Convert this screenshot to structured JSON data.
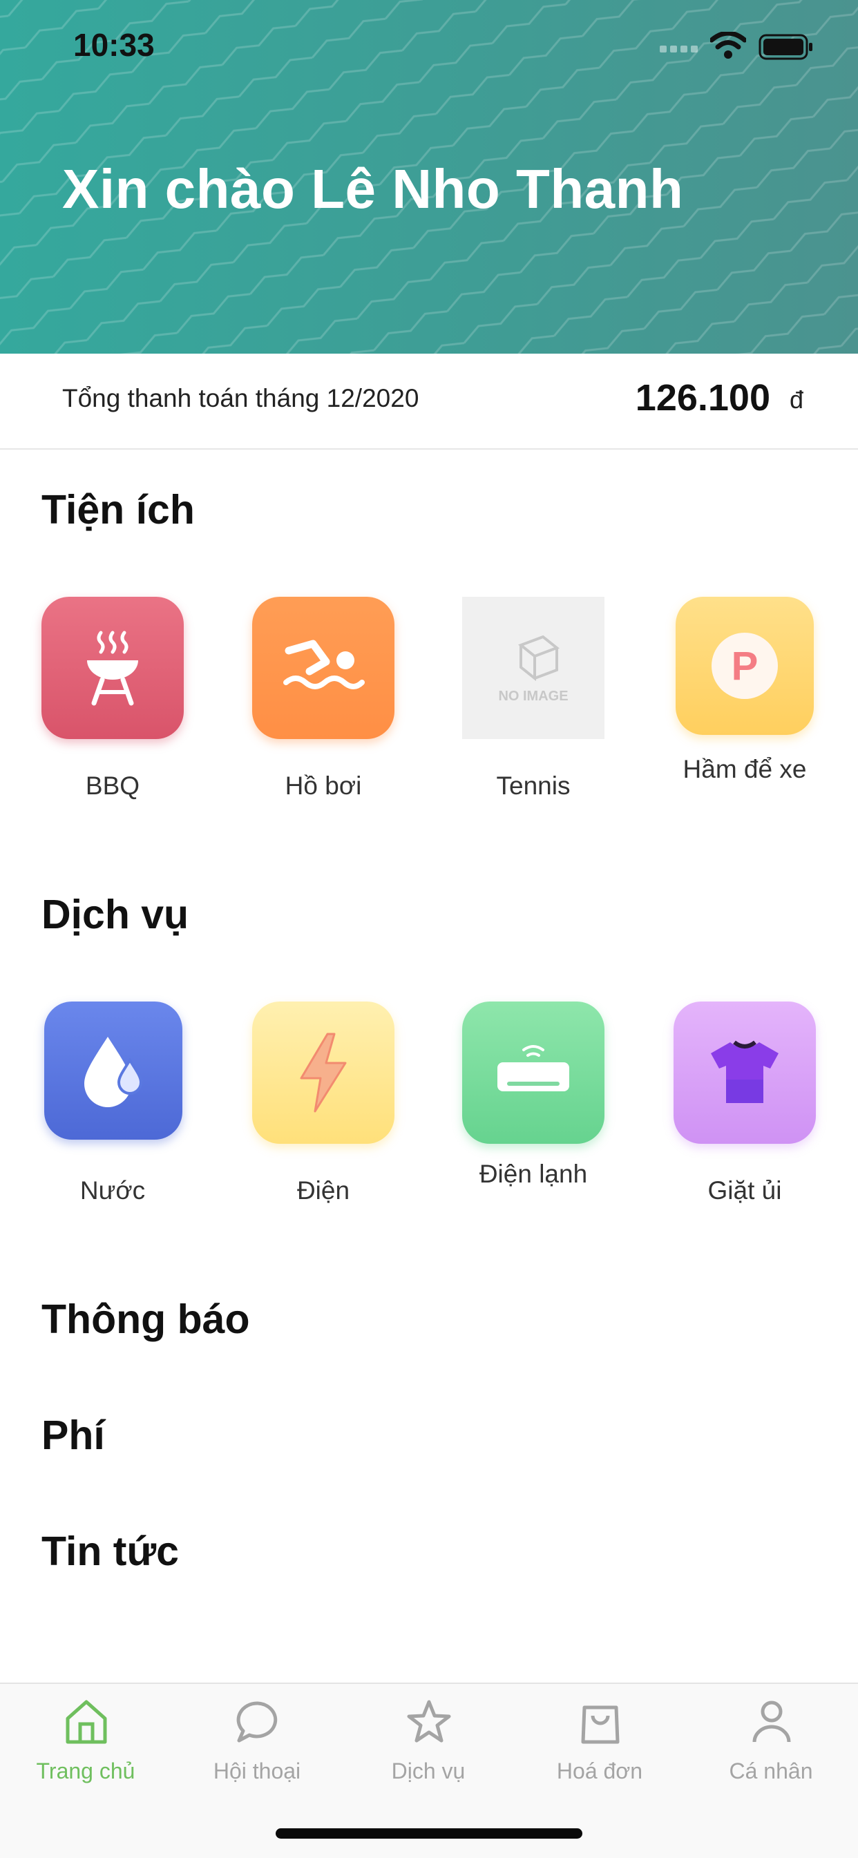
{
  "status_bar": {
    "time": "10:33"
  },
  "header": {
    "greeting": "Xin chào Lê Nho Thanh"
  },
  "payment": {
    "label": "Tổng thanh toán tháng 12/2020",
    "amount": "126.100",
    "currency": "đ"
  },
  "sections": {
    "utilities": {
      "title": "Tiện ích",
      "items": [
        {
          "label": "BBQ",
          "icon": "bbq-grill-icon",
          "color": "#e0586a"
        },
        {
          "label": "Hồ bơi",
          "icon": "swimmer-icon",
          "color": "#ff9a4f"
        },
        {
          "label": "Tennis",
          "icon": "no-image-placeholder-icon",
          "color": "#f0f0f0",
          "placeholder_text": "NO IMAGE"
        },
        {
          "label": "Hầm để xe",
          "icon": "parking-icon",
          "color": "#ffd56b"
        }
      ]
    },
    "services": {
      "title": "Dịch vụ",
      "items": [
        {
          "label": "Nước",
          "icon": "water-drop-icon",
          "color": "#5a78e0"
        },
        {
          "label": "Điện",
          "icon": "lightning-icon",
          "color": "#ffe08a"
        },
        {
          "label": "Điện lạnh",
          "icon": "air-conditioner-icon",
          "color": "#76dc9a"
        },
        {
          "label": "Giặt ủi",
          "icon": "tshirt-icon",
          "color": "#d79cf5"
        }
      ]
    },
    "notifications": {
      "title": "Thông báo"
    },
    "fees": {
      "title": "Phí"
    },
    "news": {
      "title": "Tin tức"
    }
  },
  "bottom_nav": {
    "items": [
      {
        "label": "Trang chủ",
        "icon": "home-icon",
        "active": true
      },
      {
        "label": "Hội thoại",
        "icon": "chat-bubble-icon"
      },
      {
        "label": "Dịch vụ",
        "icon": "star-icon"
      },
      {
        "label": "Hoá đơn",
        "icon": "shopping-bag-icon"
      },
      {
        "label": "Cá nhân",
        "icon": "user-icon"
      }
    ],
    "active_color": "#6fbf5e",
    "inactive_color": "#a4a4a4"
  }
}
